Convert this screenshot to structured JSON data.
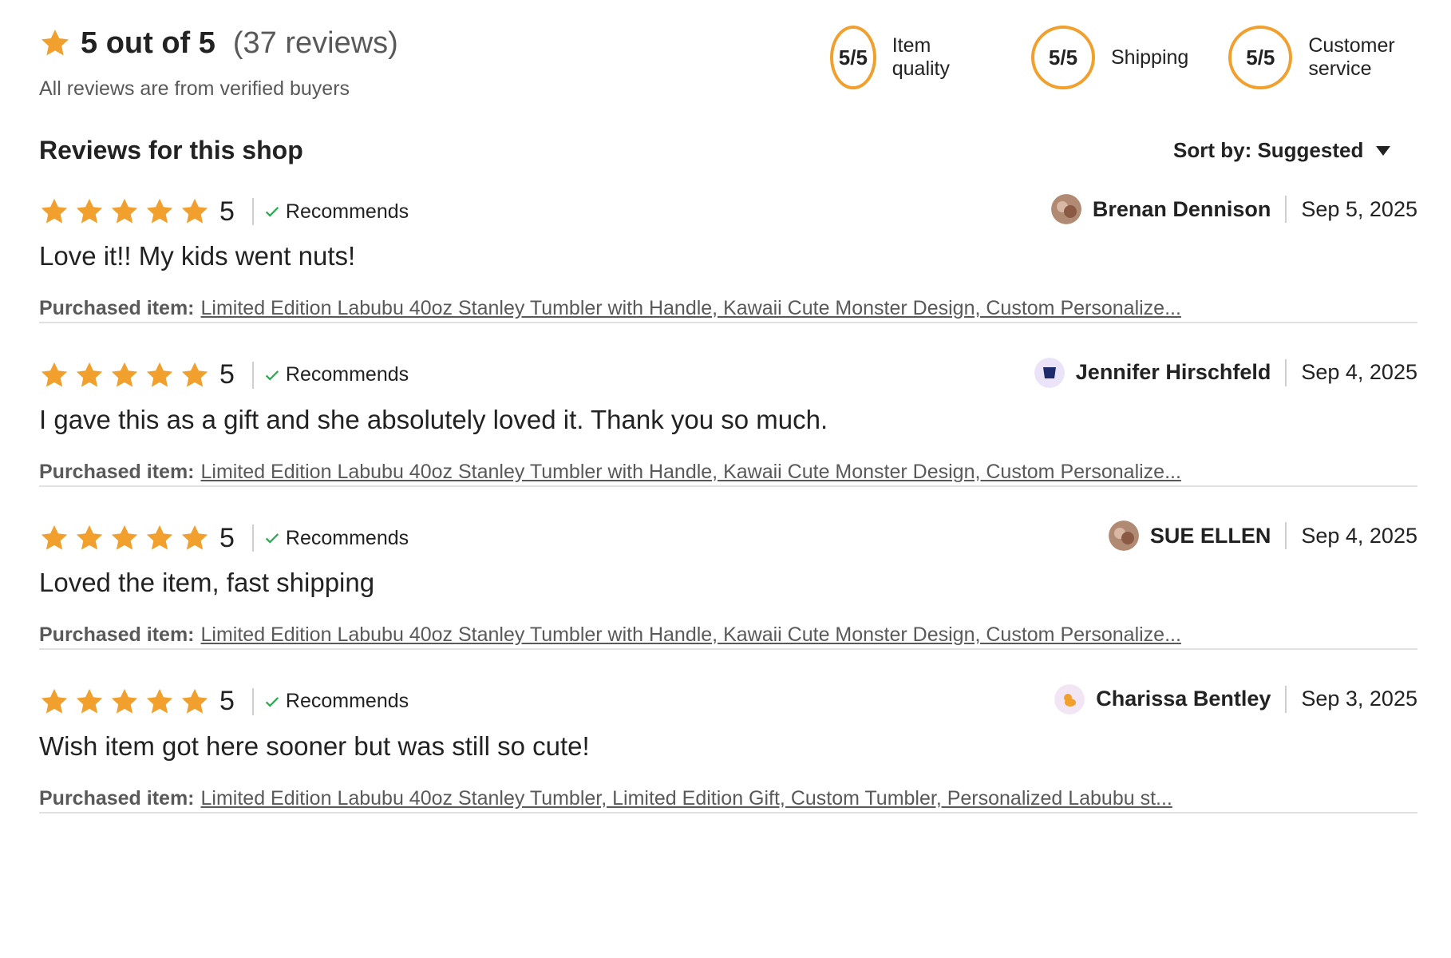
{
  "summary": {
    "score": "5 out of 5",
    "count": "(37 reviews)",
    "subtitle": "All reviews are from verified buyers"
  },
  "scores": [
    {
      "value": "5/5",
      "label": "Item quality"
    },
    {
      "value": "5/5",
      "label": "Shipping"
    },
    {
      "value": "5/5",
      "label": "Customer service"
    }
  ],
  "section_title": "Reviews for this shop",
  "sort": {
    "label": "Sort by: Suggested"
  },
  "colors": {
    "star": "#f1a02d",
    "check": "#2aa952",
    "link": "#595959"
  },
  "reviews": [
    {
      "rating": "5",
      "stars_filled": 5,
      "recommends": "Recommends",
      "author": "Brenan Dennison",
      "date": "Sep 5, 2025",
      "avatar": "photo-avatar",
      "text": "Love it!! My kids went nuts!",
      "purchased_label": "Purchased item:",
      "purchased_item": "Limited Edition Labubu 40oz Stanley Tumbler with Handle, Kawaii Cute Monster Design, Custom Personalize..."
    },
    {
      "rating": "5",
      "stars_filled": 5,
      "recommends": "Recommends",
      "author": "Jennifer Hirschfeld",
      "date": "Sep 4, 2025",
      "avatar": "cup-avatar",
      "text": "I gave this as a gift and she absolutely loved it. Thank you so much.",
      "purchased_label": "Purchased item:",
      "purchased_item": "Limited Edition Labubu 40oz Stanley Tumbler with Handle, Kawaii Cute Monster Design, Custom Personalize..."
    },
    {
      "rating": "5",
      "stars_filled": 5,
      "recommends": "Recommends",
      "author": "SUE ELLEN",
      "date": "Sep 4, 2025",
      "avatar": "photo-avatar",
      "text": "Loved the item, fast shipping",
      "purchased_label": "Purchased item:",
      "purchased_item": "Limited Edition Labubu 40oz Stanley Tumbler with Handle, Kawaii Cute Monster Design, Custom Personalize..."
    },
    {
      "rating": "5",
      "stars_filled": 5,
      "recommends": "Recommends",
      "author": "Charissa Bentley",
      "date": "Sep 3, 2025",
      "avatar": "default-avatar",
      "text": "Wish item got here sooner but was still so cute!",
      "purchased_label": "Purchased item:",
      "purchased_item": "Limited Edition Labubu 40oz Stanley Tumbler, Limited Edition Gift, Custom Tumbler, Personalized Labubu st..."
    }
  ]
}
